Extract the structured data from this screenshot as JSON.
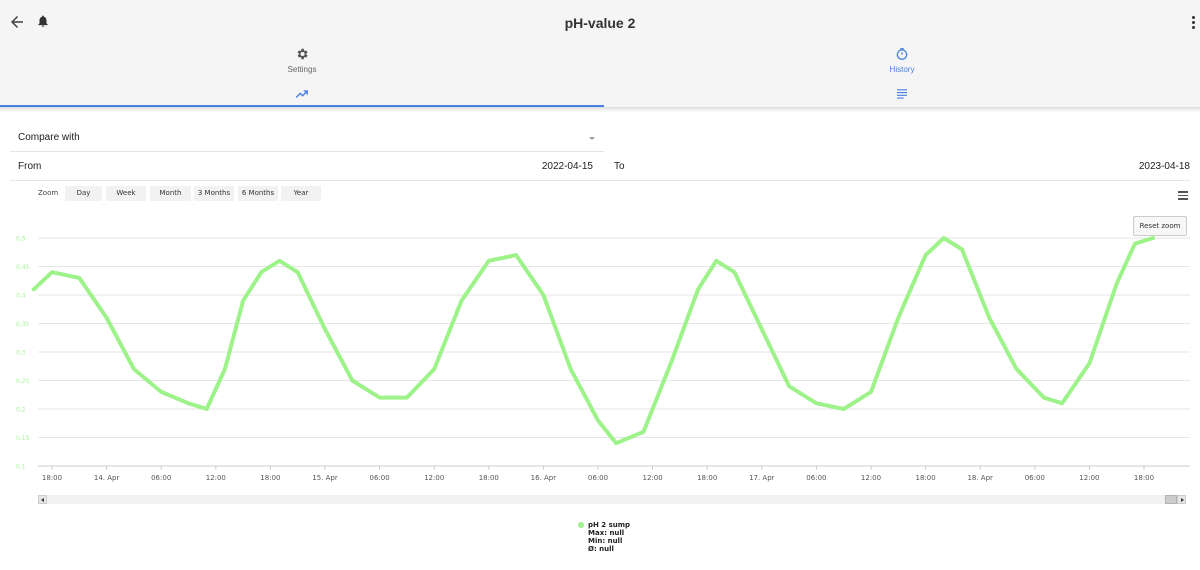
{
  "header": {
    "title": "pH-value 2"
  },
  "tabs": [
    {
      "label": "Settings"
    },
    {
      "label": "History"
    }
  ],
  "form": {
    "compare_label": "Compare with",
    "from_label": "From",
    "from_value": "2022-04-15",
    "to_label": "To",
    "to_value": "2023-04-18"
  },
  "toolbar": {
    "zoom_label": "Zoom",
    "zoom_buttons": [
      "Day",
      "Week",
      "Month",
      "3 Months",
      "6 Months",
      "Year"
    ],
    "reset_zoom": "Reset zoom"
  },
  "colors": {
    "accent": "#4a7fe3",
    "series": "#9ef28a"
  },
  "chart_data": {
    "type": "line",
    "y_ticks": [
      "0,5",
      "0,45",
      "0,4",
      "0,35",
      "0,3",
      "0,25",
      "0,2",
      "0,15",
      "0,1"
    ],
    "ylim": [
      0.1,
      0.5
    ],
    "x_ticks": [
      "18:00",
      "14. Apr",
      "06:00",
      "12:00",
      "18:00",
      "15. Apr",
      "06:00",
      "12:00",
      "18:00",
      "16. Apr",
      "06:00",
      "12:00",
      "18:00",
      "17. Apr",
      "06:00",
      "12:00",
      "18:00",
      "18. Apr",
      "06:00",
      "12:00",
      "18:00"
    ],
    "grid": true,
    "series": [
      {
        "name": "pH 2 sump",
        "x": [
          "13. Apr 16:00",
          "13. Apr 18:00",
          "13. Apr 21:00",
          "14. Apr 00:00",
          "14. Apr 03:00",
          "14. Apr 06:00",
          "14. Apr 09:00",
          "14. Apr 11:00",
          "14. Apr 13:00",
          "14. Apr 15:00",
          "14. Apr 17:00",
          "14. Apr 19:00",
          "14. Apr 21:00",
          "15. Apr 00:00",
          "15. Apr 03:00",
          "15. Apr 06:00",
          "15. Apr 09:00",
          "15. Apr 12:00",
          "15. Apr 15:00",
          "15. Apr 18:00",
          "15. Apr 21:00",
          "16. Apr 00:00",
          "16. Apr 03:00",
          "16. Apr 06:00",
          "16. Apr 08:00",
          "16. Apr 11:00",
          "16. Apr 14:00",
          "16. Apr 17:00",
          "16. Apr 19:00",
          "16. Apr 21:00",
          "17. Apr 00:00",
          "17. Apr 03:00",
          "17. Apr 06:00",
          "17. Apr 09:00",
          "17. Apr 12:00",
          "17. Apr 15:00",
          "17. Apr 18:00",
          "17. Apr 20:00",
          "17. Apr 22:00",
          "18. Apr 01:00",
          "18. Apr 04:00",
          "18. Apr 07:00",
          "18. Apr 09:00",
          "18. Apr 12:00",
          "18. Apr 15:00",
          "18. Apr 17:00",
          "18. Apr 19:00"
        ],
        "values": [
          0.41,
          0.44,
          0.43,
          0.36,
          0.27,
          0.23,
          0.21,
          0.2,
          0.27,
          0.39,
          0.44,
          0.46,
          0.44,
          0.34,
          0.25,
          0.22,
          0.22,
          0.27,
          0.39,
          0.46,
          0.47,
          0.4,
          0.27,
          0.18,
          0.14,
          0.16,
          0.28,
          0.41,
          0.46,
          0.44,
          0.34,
          0.24,
          0.21,
          0.2,
          0.23,
          0.36,
          0.47,
          0.5,
          0.48,
          0.36,
          0.27,
          0.22,
          0.21,
          0.28,
          0.42,
          0.49,
          0.5
        ]
      }
    ],
    "legend": {
      "name": "pH 2 sump",
      "max": "Max: null",
      "min": "Min: null",
      "avg": "Ø: null",
      "position": "bottom-center"
    }
  }
}
